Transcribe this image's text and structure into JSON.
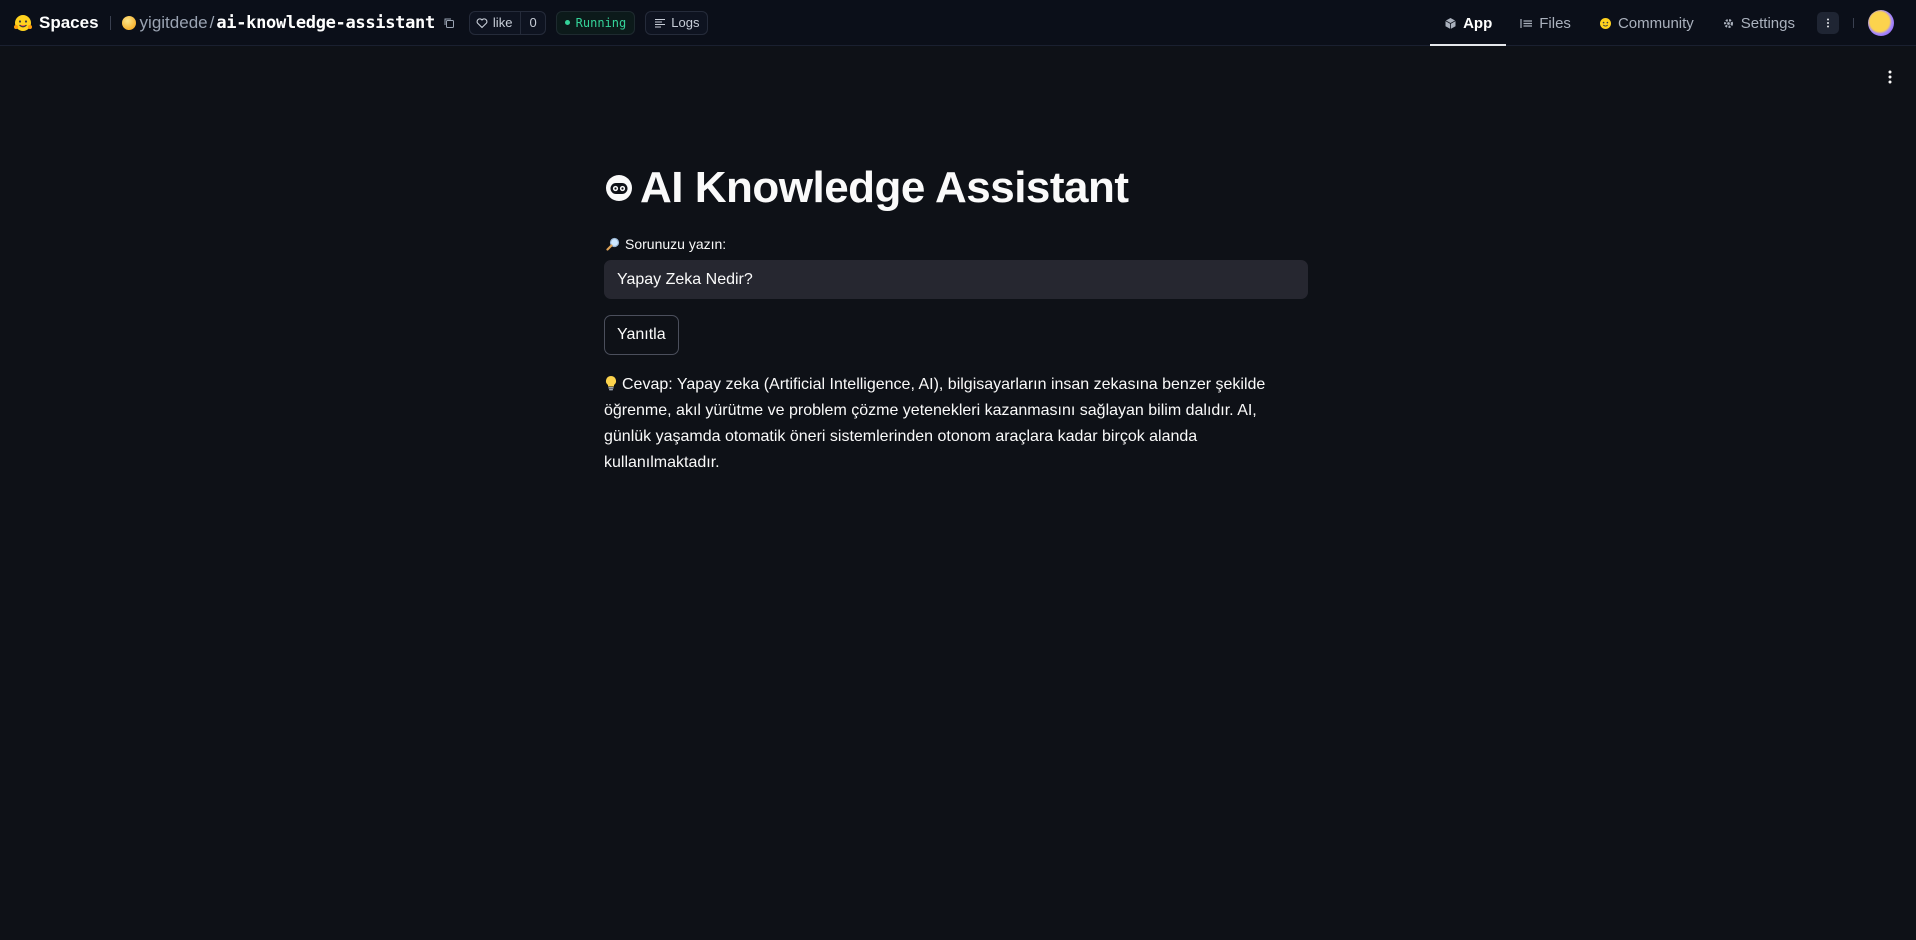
{
  "header": {
    "brand": "Spaces",
    "owner": "yigitdede",
    "separator": "/",
    "repo": "ai-knowledge-assistant",
    "like_label": "like",
    "like_count": "0",
    "status": "Running",
    "logs_label": "Logs",
    "tabs": [
      {
        "label": "App",
        "icon": "app-cube-icon",
        "active": true
      },
      {
        "label": "Files",
        "icon": "files-icon",
        "active": false
      },
      {
        "label": "Community",
        "icon": "community-icon",
        "active": false
      },
      {
        "label": "Settings",
        "icon": "gear-icon",
        "active": false
      }
    ]
  },
  "main": {
    "title": "AI Knowledge Assistant",
    "question_label": "Sorunuzu yazın:",
    "question_value": "Yapay Zeka Nedir?",
    "submit_label": "Yanıtla",
    "answer": "Cevap: Yapay zeka (Artificial Intelligence, AI), bilgisayarların insan zekasına benzer şekilde öğrenme, akıl yürütme ve problem çözme yetenekleri kazanmasını sağlayan bilim dalıdır. AI, günlük yaşamda otomatik öneri sistemlerinden otonom araçlara kadar birçok alanda kullanılmaktadır."
  },
  "colors": {
    "background": "#0e1117",
    "header_bg": "#0b0f19",
    "input_bg": "#262730",
    "status_green": "#34d399"
  }
}
